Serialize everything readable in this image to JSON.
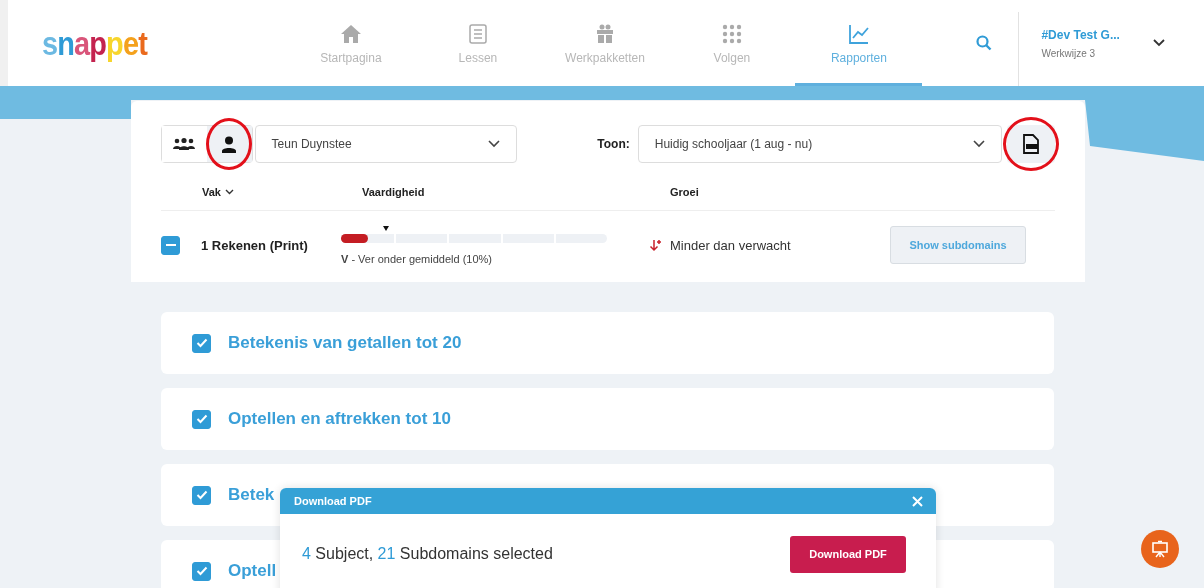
{
  "logo": {
    "letters": [
      {
        "text": "s",
        "color": "#6cb9e2"
      },
      {
        "text": "n",
        "color": "#2f9bd6"
      },
      {
        "text": "a",
        "color": "#d9557a"
      },
      {
        "text": "p",
        "color": "#c4234f"
      },
      {
        "text": "p",
        "color": "#f7d52c"
      },
      {
        "text": "e",
        "color": "#f4a11c"
      },
      {
        "text": "t",
        "color": "#ea6a1d"
      }
    ]
  },
  "nav": {
    "items": [
      {
        "label": "Startpagina",
        "kind": "home",
        "selected": false
      },
      {
        "label": "Lessen",
        "kind": "list",
        "selected": false
      },
      {
        "label": "Werkpakketten",
        "kind": "gift",
        "selected": false
      },
      {
        "label": "Volgen",
        "kind": "grid",
        "selected": false
      },
      {
        "label": "Rapporten",
        "kind": "chart",
        "selected": true
      }
    ]
  },
  "account": {
    "name": "#Dev Test G...",
    "subtitle": "Werkwijze 3"
  },
  "filters": {
    "view_modes": [
      {
        "kind": "group",
        "selected": false,
        "annotated": false
      },
      {
        "kind": "single",
        "selected": true,
        "annotated": true
      }
    ],
    "student": {
      "value": "Teun Duynstee"
    },
    "period": {
      "label": "Toon:",
      "value": "Huidig schooljaar (1 aug - nu)"
    },
    "pdf_button": {
      "annotated": true
    }
  },
  "table": {
    "columns": [
      "Vak",
      "Vaardigheid",
      "Groei"
    ],
    "rows": [
      {
        "indeterminate": true,
        "subject": "1 Rekenen (Print)",
        "bar": {
          "level": 0.1
        },
        "marker": {
          "level": 0.17
        },
        "skill": "**V** - Ver onder gemiddeld (10%)",
        "growth": {
          "kind": "down",
          "text": "Minder dan verwacht"
        },
        "action": "Show subdomains"
      }
    ]
  },
  "domains": [
    {
      "title": "Betekenis van getallen tot 20",
      "checked": true
    },
    {
      "title": "Optellen en aftrekken tot 10",
      "checked": true
    },
    {
      "title": "Betek",
      "checked": true
    },
    {
      "title": "Optell",
      "checked": true
    }
  ],
  "modal": {
    "title": "Download PDF",
    "summary": [
      {
        "text": "4",
        "highlight": true
      },
      {
        "text": " Subject, ",
        "highlight": false
      },
      {
        "text": "21",
        "highlight": true
      },
      {
        "text": " Subdomains selected",
        "highlight": false
      }
    ],
    "button": "Download PDF"
  }
}
